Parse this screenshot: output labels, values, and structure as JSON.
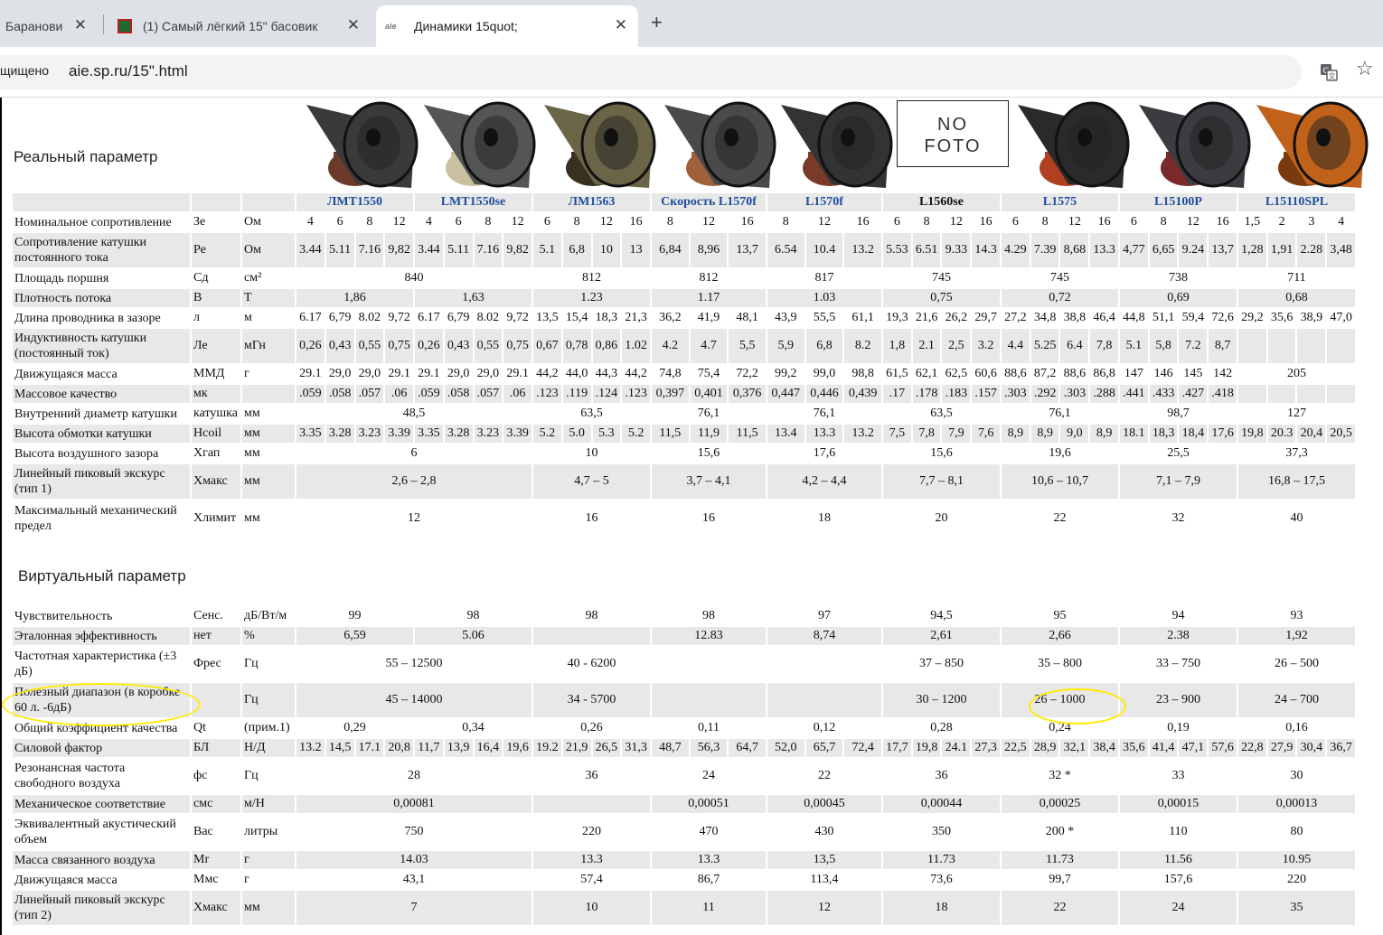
{
  "browser": {
    "tabs": [
      {
        "title": "Баранови"
      },
      {
        "title": "(1) Самый лёгкий 15\" басовик"
      },
      {
        "title": "Динамики 15quot;"
      }
    ],
    "security_label": "щищено",
    "url": "aie.sp.ru/15\".html"
  },
  "page": {
    "real_heading": "Реальный параметр",
    "virtual_heading": "Виртуальный параметр",
    "no_foto": [
      "NO",
      "FOTO"
    ],
    "models": [
      "ЛМТ1550",
      "LMT1550se",
      "ЛМ1563",
      "Скорость L1570f",
      "L1570f",
      "L1560se",
      "L1575",
      "L15100P",
      "L15110SPL"
    ],
    "real_rows": [
      {
        "name": "Номинальное сопротивление",
        "sym": "Зе",
        "unit": "Ом",
        "vals": [
          "4",
          "6",
          "8",
          "12",
          "4",
          "6",
          "8",
          "12",
          "6",
          "8",
          "12",
          "16",
          "8",
          "12",
          "16",
          "8",
          "12",
          "16",
          "6",
          "8",
          "12",
          "16",
          "6",
          "8",
          "12",
          "16",
          "6",
          "8",
          "12",
          "16",
          "1,5",
          "2",
          "3",
          "4"
        ]
      },
      {
        "name": "Сопротивление катушки постоянного тока",
        "sym": "Ре",
        "unit": "Ом",
        "vals": [
          "3.44",
          "5.11",
          "7.16",
          "9,82",
          "3.44",
          "5.11",
          "7.16",
          "9,82",
          "5.1",
          "6,8",
          "10",
          "13",
          "6,84",
          "8,96",
          "13,7",
          "6.54",
          "10.4",
          "13.2",
          "5.53",
          "6.51",
          "9.33",
          "14.3",
          "4.29",
          "7.39",
          "8,68",
          "13.3",
          "4,77",
          "6,65",
          "9.24",
          "13,7",
          "1,28",
          "1,91",
          "2.28",
          "3,48"
        ]
      },
      {
        "name": "Площадь поршня",
        "sym": "Сд",
        "unit": "см²",
        "merged": [
          "840",
          "812",
          "812",
          "817",
          "745",
          "745",
          "738",
          "711"
        ]
      },
      {
        "name": "Плотность потока",
        "sym": "В",
        "unit": "Т",
        "merged": [
          "1,86",
          "1,63",
          "1.23",
          "1.17",
          "1.03",
          "0,75",
          "0,72",
          "0,69",
          "0,68"
        ]
      },
      {
        "name": "Длина проводника в зазоре",
        "sym": "л",
        "unit": "м",
        "vals": [
          "6.17",
          "6,79",
          "8.02",
          "9,72",
          "6.17",
          "6,79",
          "8.02",
          "9,72",
          "13,5",
          "15,4",
          "18,3",
          "21,3",
          "36,2",
          "41,9",
          "48,1",
          "43,9",
          "55,5",
          "61,1",
          "19,3",
          "21,6",
          "26,2",
          "29,7",
          "27,2",
          "34,8",
          "38,8",
          "46,4",
          "44,8",
          "51,1",
          "59,4",
          "72,6",
          "29,2",
          "35,6",
          "38,9",
          "47,0"
        ]
      },
      {
        "name": "Индуктивность катушки (постоянный ток)",
        "sym": "Ле",
        "unit": "мГн",
        "vals": [
          "0,26",
          "0,43",
          "0,55",
          "0,75",
          "0,26",
          "0,43",
          "0,55",
          "0,75",
          "0,67",
          "0,78",
          "0,86",
          "1.02",
          "4.2",
          "4.7",
          "5,5",
          "5,9",
          "6,8",
          "8.2",
          "1,8",
          "2.1",
          "2,5",
          "3.2",
          "4.4",
          "5.25",
          "6.4",
          "7,8",
          "5.1",
          "5,8",
          "7.2",
          "8,7",
          "",
          "",
          "",
          ""
        ]
      },
      {
        "name": "Движущаяся масса",
        "sym": "ММД",
        "unit": "г",
        "vals": [
          "29.1",
          "29,0",
          "29,0",
          "29.1",
          "29.1",
          "29,0",
          "29,0",
          "29.1",
          "44,2",
          "44,0",
          "44,3",
          "44,2",
          "74,8",
          "75,4",
          "72,2",
          "99,2",
          "99,0",
          "98,8",
          "61,5",
          "62,1",
          "62,5",
          "60,6",
          "88,6",
          "87,2",
          "88,6",
          "86,8",
          "147",
          "146",
          "145",
          "142"
        ],
        "last": "205"
      },
      {
        "name": "Массовое качество",
        "sym": "мк",
        "unit": "",
        "vals": [
          ".059",
          ".058",
          ".057",
          ".06",
          ".059",
          ".058",
          ".057",
          ".06",
          ".123",
          ".119",
          ".124",
          ".123",
          "0,397",
          "0,401",
          "0,376",
          "0,447",
          "0,446",
          "0,439",
          ".17",
          ".178",
          ".183",
          ".157",
          ".303",
          ".292",
          ".303",
          ".288",
          ".441",
          ".433",
          ".427",
          ".418",
          "",
          "",
          "",
          ""
        ]
      },
      {
        "name": "Внутренний диаметр катушки",
        "sym": "катушка",
        "unit": "мм",
        "merged": [
          "48,5",
          "63,5",
          "76,1",
          "76,1",
          "63,5",
          "76,1",
          "98,7",
          "127"
        ]
      },
      {
        "name": "Высота обмотки катушки",
        "sym": "Hcoil",
        "unit": "мм",
        "vals": [
          "3.35",
          "3.28",
          "3.23",
          "3.39",
          "3.35",
          "3.28",
          "3.23",
          "3.39",
          "5.2",
          "5.0",
          "5.3",
          "5.2",
          "11,5",
          "11,9",
          "11,5",
          "13.4",
          "13.3",
          "13.2",
          "7,5",
          "7,8",
          "7,9",
          "7,6",
          "8,9",
          "8,9",
          "9,0",
          "8,9",
          "18.1",
          "18,3",
          "18,4",
          "17,6",
          "19,8",
          "20.3",
          "20,4",
          "20,5"
        ]
      },
      {
        "name": "Высота воздушного зазора",
        "sym": "Хгап",
        "unit": "мм",
        "merged": [
          "6",
          "10",
          "15,6",
          "17,6",
          "15,6",
          "19,6",
          "25,5",
          "37,3"
        ]
      },
      {
        "name": "Линейный пиковый экскурс (тип 1)",
        "sym": "Хмакс",
        "unit": "мм",
        "merged": [
          "2,6 – 2,8",
          "4,7 – 5",
          "3,7 – 4,1",
          "4,2 – 4,4",
          "7,7 – 8,1",
          "10,6 – 10,7",
          "7,1 – 7,9",
          "16,8 – 17,5"
        ]
      },
      {
        "name": "Максимальный механический предел",
        "sym": "Хлимит",
        "unit": "мм",
        "merged": [
          "12",
          "16",
          "16",
          "18",
          "20",
          "22",
          "32",
          "40"
        ]
      }
    ],
    "virtual_rows": [
      {
        "name": "Чувствительность",
        "sym": "Сенс.",
        "unit": "дБ/Вт/м",
        "merged": [
          "99",
          "98",
          "98",
          "98",
          "97",
          "94,5",
          "95",
          "94",
          "93"
        ]
      },
      {
        "name": "Эталонная эффективность",
        "sym": "нет",
        "unit": "%",
        "merged": [
          "6,59",
          "5.06",
          "",
          "12.83",
          "8,74",
          "2,61",
          "2,66",
          "2.38",
          "1,92"
        ]
      },
      {
        "name": "Частотная характеристика (±3 дБ)",
        "sym": "Фрес",
        "unit": "Гц",
        "merged": [
          "55 – 12500",
          "40 - 6200",
          "",
          "",
          "37 – 850",
          "35 – 800",
          "33 – 750",
          "26 – 500"
        ]
      },
      {
        "name": "Полезный диапазон (в коробке 60 л. -6дБ)",
        "sym": "",
        "unit": "Гц",
        "merged": [
          "45 – 14000",
          "34 - 5700",
          "",
          "",
          "30 – 1200",
          "26 – 1000",
          "23 – 900",
          "24 – 700"
        ]
      },
      {
        "name": "Общий коэффициент качества",
        "sym": "Qt",
        "unit": "(прим.1)",
        "merged": [
          "0,29",
          "0,34",
          "0,26",
          "0,11",
          "0,12",
          "0,28",
          "0,24",
          "0,19",
          "0,16"
        ]
      },
      {
        "name": "Силовой фактор",
        "sym": "БЛ",
        "unit": "Н/Д",
        "vals": [
          "13.2",
          "14,5",
          "17.1",
          "20,8",
          "11,7",
          "13,9",
          "16,4",
          "19,6",
          "19.2",
          "21,9",
          "26,5",
          "31,3",
          "48,7",
          "56,3",
          "64,7",
          "52,0",
          "65,7",
          "72,4",
          "17,7",
          "19,8",
          "24.1",
          "27,3",
          "22,5",
          "28,9",
          "32,1",
          "38,4",
          "35,6",
          "41,4",
          "47,1",
          "57,6",
          "22,8",
          "27,9",
          "30,4",
          "36,7"
        ]
      },
      {
        "name": "Резонансная частота свободного воздуха",
        "sym": "фс",
        "unit": "Гц",
        "merged": [
          "28",
          "36",
          "24",
          "22",
          "36",
          "32 *",
          "33",
          "30"
        ]
      },
      {
        "name": "Механическое соответствие",
        "sym": "смс",
        "unit": "м/Н",
        "merged": [
          "0,00081",
          "",
          "0,00051",
          "0,00045",
          "0,00044",
          "0,00025",
          "0,00015",
          "0,00013"
        ]
      },
      {
        "name": "Эквивалентный акустический объем",
        "sym": "Вас",
        "unit": "литры",
        "merged": [
          "750",
          "220",
          "470",
          "430",
          "350",
          "200 *",
          "110",
          "80"
        ]
      },
      {
        "name": "Масса связанного воздуха",
        "sym": "Мr",
        "unit": "г",
        "merged": [
          "14.03",
          "13.3",
          "13.3",
          "13,5",
          "11.73",
          "11.73",
          "11.56",
          "10.95"
        ]
      },
      {
        "name": "Движущаяся масса",
        "sym": "Ммс",
        "unit": "г",
        "merged": [
          "43,1",
          "57,4",
          "86,7",
          "113,4",
          "73,6",
          "99,7",
          "157,6",
          "220"
        ]
      },
      {
        "name": "Линейный пиковый экскурс (тип 2)",
        "sym": "Хмакс",
        "unit": "мм",
        "merged": [
          "7",
          "10",
          "11",
          "12",
          "18",
          "22",
          "24",
          "35"
        ]
      }
    ]
  }
}
